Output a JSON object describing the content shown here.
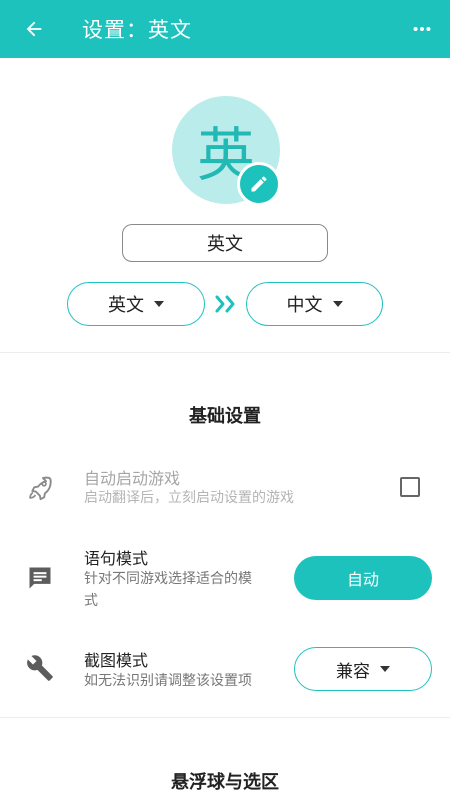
{
  "appbar": {
    "title": "设置：英文",
    "back_icon": "arrow-left-icon",
    "more_icon": "more-horizontal-icon",
    "color": "#1ec2bd"
  },
  "profile": {
    "avatar_char": "英",
    "edit_icon": "pencil-icon",
    "name": "英文"
  },
  "language": {
    "source": "英文",
    "target": "中文",
    "arrow_icon": "double-chevron-right-icon"
  },
  "basic_settings": {
    "title": "基础设置",
    "auto_start": {
      "icon": "rocket-icon",
      "title": "自动启动游戏",
      "subtitle": "启动翻译后，立刻启动设置的游戏",
      "checked": false
    },
    "sentence_mode": {
      "icon": "message-icon",
      "title": "语句模式",
      "subtitle_line1": "针对不同游戏选择适合的模",
      "subtitle_line2": "式",
      "value": "自动"
    },
    "screenshot_mode": {
      "icon": "wrench-icon",
      "title": "截图模式",
      "subtitle": "如无法识别请调整该设置项",
      "value": "兼容"
    }
  },
  "float_section": {
    "title": "悬浮球与选区"
  }
}
